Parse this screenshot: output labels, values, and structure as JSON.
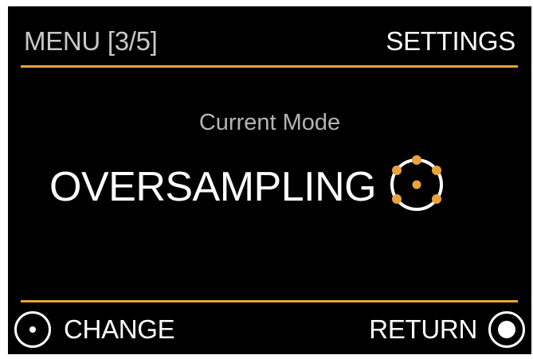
{
  "header": {
    "menu_position": "MENU [3/5]",
    "title": "SETTINGS"
  },
  "main": {
    "mode_label": "Current Mode",
    "mode_value": "OVERSAMPLING",
    "mode_icon": "oversampling-dots-icon"
  },
  "footer": {
    "left_button": {
      "label": "CHANGE",
      "icon": "knob-small-dot-icon"
    },
    "right_button": {
      "label": "RETURN",
      "icon": "knob-large-dot-icon"
    }
  },
  "colors": {
    "background": "#000000",
    "accent": "#e8a33a",
    "text": "#ffffff",
    "text_dim": "#c8c8c8"
  }
}
